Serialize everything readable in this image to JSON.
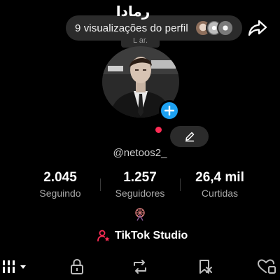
{
  "header": {
    "profile_views": "9 visualizações do perfil",
    "tooltip_fragment": "L ar."
  },
  "profile": {
    "display_name": "رمادا",
    "username": "@netoos2_"
  },
  "stats": [
    {
      "value": "2.045",
      "label": "Seguindo"
    },
    {
      "value": "1.257",
      "label": "Seguidores"
    },
    {
      "value": "26,4 mil",
      "label": "Curtidas"
    }
  ],
  "studio": {
    "label": "TikTok Studio"
  },
  "colors": {
    "accent_blue": "#1da1f2",
    "accent_red": "#fe2c55",
    "pill_bg": "#2b2b2b"
  },
  "icons": {
    "share": "share-arrow-icon",
    "edit": "pencil-icon",
    "add": "plus-icon",
    "bio": "ferris-wheel-icon",
    "studio": "person-star-icon",
    "tabs": [
      "grid-icon",
      "lock-icon",
      "repost-icon",
      "saved-icon",
      "liked-icon"
    ]
  }
}
